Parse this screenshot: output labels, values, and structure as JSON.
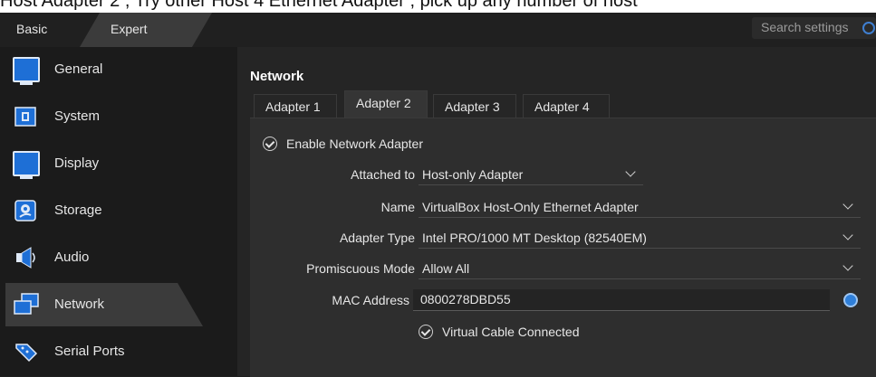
{
  "top_strip": {
    "text": "Host Adapter 2 , Try other Host 4 Ethernet Adapter , pick up any number of host"
  },
  "toolbar": {
    "mode_basic": "Basic",
    "mode_expert": "Expert",
    "search_placeholder": "Search settings"
  },
  "sidebar": {
    "items": [
      {
        "label": "General",
        "icon": "general-icon"
      },
      {
        "label": "System",
        "icon": "system-icon"
      },
      {
        "label": "Display",
        "icon": "display-icon"
      },
      {
        "label": "Storage",
        "icon": "storage-icon"
      },
      {
        "label": "Audio",
        "icon": "audio-icon"
      },
      {
        "label": "Network",
        "icon": "network-icon",
        "active": true
      },
      {
        "label": "Serial Ports",
        "icon": "serial-ports-icon"
      }
    ]
  },
  "main": {
    "section_title": "Network",
    "tabs": [
      {
        "label": "Adapter 1"
      },
      {
        "label": "Adapter 2",
        "active": true
      },
      {
        "label": "Adapter 3"
      },
      {
        "label": "Adapter 4"
      }
    ],
    "enable_adapter": {
      "label": "Enable Network Adapter",
      "checked": true
    },
    "attached_to": {
      "label": "Attached to",
      "value": "Host-only Adapter"
    },
    "name": {
      "label": "Name",
      "value": "VirtualBox Host-Only Ethernet Adapter"
    },
    "adapter_type": {
      "label": "Adapter Type",
      "value": "Intel PRO/1000 MT Desktop (82540EM)"
    },
    "promiscuous_mode": {
      "label": "Promiscuous Mode",
      "value": "Allow All"
    },
    "mac_address": {
      "label": "MAC Address",
      "value": "0800278DBD55"
    },
    "cable_connected": {
      "label": "Virtual Cable Connected",
      "checked": true
    }
  },
  "colors": {
    "background": "#1f1f1f",
    "panel": "#2e2e2e",
    "accent": "#2f7fd9",
    "active_item": "#3b3b3b"
  }
}
